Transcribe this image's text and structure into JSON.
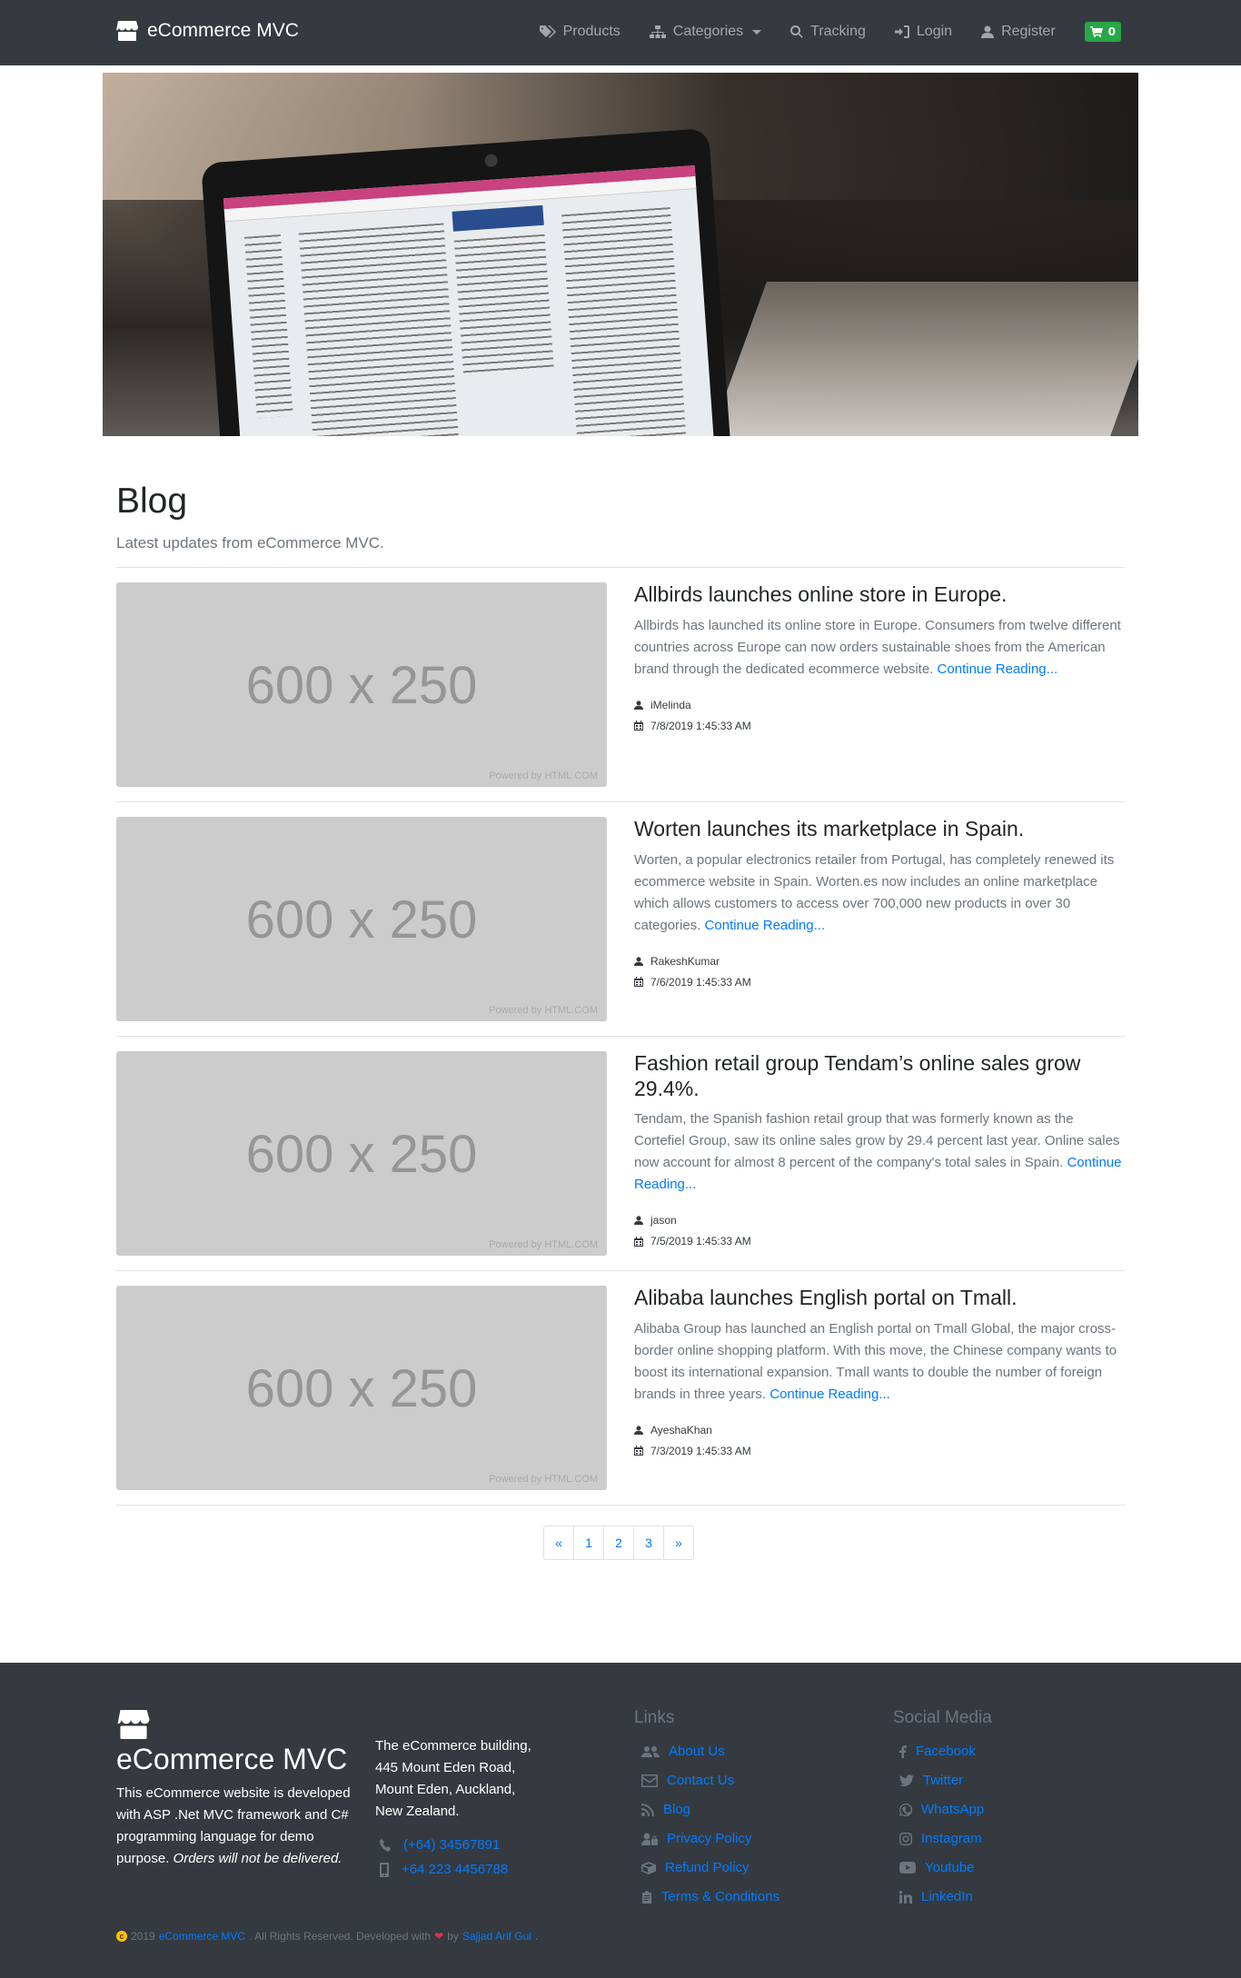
{
  "navbar": {
    "brand": "eCommerce MVC",
    "items": [
      {
        "label": "Products",
        "icon": "tags-icon"
      },
      {
        "label": "Categories",
        "icon": "sitemap-icon"
      },
      {
        "label": "Tracking",
        "icon": "search-icon"
      },
      {
        "label": "Login",
        "icon": "sign-in-icon"
      },
      {
        "label": "Register",
        "icon": "user-icon"
      }
    ],
    "cart_count": "0"
  },
  "page": {
    "title": "Blog",
    "subtitle": "Latest updates from eCommerce MVC."
  },
  "posts": [
    {
      "image_text": "600 x 250",
      "image_powered": "Powered by HTML.COM",
      "title": "Allbirds launches online store in Europe.",
      "excerpt": "Allbirds has launched its online store in Europe. Consumers from twelve different countries across Europe can now orders sustainable shoes from the American brand through the dedicated ecommerce website.",
      "read_more": "Continue Reading...",
      "author": "iMelinda",
      "date": "7/8/2019 1:45:33 AM"
    },
    {
      "image_text": "600 x 250",
      "image_powered": "Powered by HTML.COM",
      "title": "Worten launches its marketplace in Spain.",
      "excerpt": "Worten, a popular electronics retailer from Portugal, has completely renewed its ecommerce website in Spain. Worten.es now includes an online marketplace which allows customers to access over 700,000 new products in over 30 categories.",
      "read_more": "Continue Reading...",
      "author": "RakeshKumar",
      "date": "7/6/2019 1:45:33 AM"
    },
    {
      "image_text": "600 x 250",
      "image_powered": "Powered by HTML.COM",
      "title": "Fashion retail group Tendam’s online sales grow 29.4%.",
      "excerpt": "Tendam, the Spanish fashion retail group that was formerly known as the Cortefiel Group, saw its online sales grow by 29.4 percent last year. Online sales now account for almost 8 percent of the company's total sales in Spain.",
      "read_more": "Continue Reading...",
      "author": "jason",
      "date": "7/5/2019 1:45:33 AM"
    },
    {
      "image_text": "600 x 250",
      "image_powered": "Powered by HTML.COM",
      "title": "Alibaba launches English portal on Tmall.",
      "excerpt": "Alibaba Group has launched an English portal on Tmall Global, the major cross-border online shopping platform. With this move, the Chinese company wants to boost its international expansion. Tmall wants to double the number of foreign brands in three years.",
      "read_more": "Continue Reading...",
      "author": "AyeshaKhan",
      "date": "7/3/2019 1:45:33 AM"
    }
  ],
  "pagination": {
    "prev": "«",
    "pages": [
      "1",
      "2",
      "3"
    ],
    "next": "»"
  },
  "footer": {
    "brand": "eCommerce MVC",
    "about_main": "This eCommerce website is developed with ASP .Net MVC framework and C# programming language for demo purpose.",
    "about_note": "Orders will not be delivered.",
    "address": [
      "The eCommerce building,",
      "445 Mount Eden Road,",
      "Mount Eden, Auckland,",
      "New Zealand."
    ],
    "phone": "(+64) 34567891",
    "mobile": "+64 223 4456788",
    "links_heading": "Links",
    "links": [
      {
        "label": "About Us",
        "icon": "users-icon"
      },
      {
        "label": "Contact Us",
        "icon": "envelope-icon"
      },
      {
        "label": "Blog",
        "icon": "rss-icon"
      },
      {
        "label": "Privacy Policy",
        "icon": "user-lock-icon"
      },
      {
        "label": "Refund Policy",
        "icon": "box-icon"
      },
      {
        "label": "Terms & Conditions",
        "icon": "clipboard-icon"
      }
    ],
    "social_heading": "Social Media",
    "social": [
      {
        "label": "Facebook",
        "icon": "facebook-icon"
      },
      {
        "label": "Twitter",
        "icon": "twitter-icon"
      },
      {
        "label": "WhatsApp",
        "icon": "whatsapp-icon"
      },
      {
        "label": "Instagram",
        "icon": "instagram-icon"
      },
      {
        "label": "Youtube",
        "icon": "youtube-icon"
      },
      {
        "label": "LinkedIn",
        "icon": "linkedin-icon"
      }
    ],
    "copyright_year": "2019",
    "copyright_brand": "eCommerce MVC",
    "copyright_rights": ". All Rights Reserved. Developed with",
    "copyright_by": "by",
    "copyright_author": "Sajjad Arif Gul",
    "copyright_end": "."
  },
  "colors": {
    "navbar_bg": "#343a40",
    "link": "#007bff",
    "cart_badge": "#28a745",
    "placeholder_bg": "#cccccc"
  }
}
